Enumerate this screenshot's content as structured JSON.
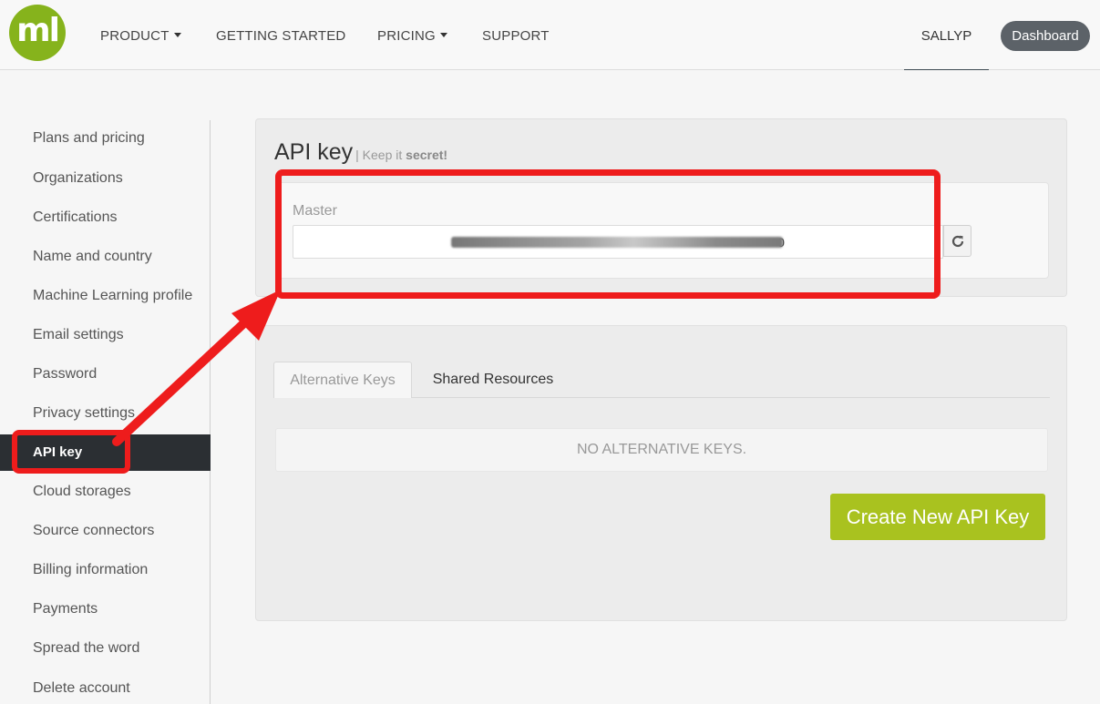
{
  "header": {
    "logo_text": "ml",
    "nav": [
      {
        "label": "PRODUCT",
        "has_caret": true
      },
      {
        "label": "GETTING STARTED",
        "has_caret": false
      },
      {
        "label": "PRICING",
        "has_caret": true
      },
      {
        "label": "SUPPORT",
        "has_caret": false
      }
    ],
    "username": "SALLYP",
    "dashboard_label": "Dashboard"
  },
  "sidebar": {
    "items": [
      {
        "label": "Plans and pricing"
      },
      {
        "label": "Organizations"
      },
      {
        "label": "Certifications"
      },
      {
        "label": "Name and country"
      },
      {
        "label": "Machine Learning profile"
      },
      {
        "label": "Email settings"
      },
      {
        "label": "Password"
      },
      {
        "label": "Privacy settings"
      },
      {
        "label": "API key",
        "active": true
      },
      {
        "label": "Cloud storages"
      },
      {
        "label": "Source connectors"
      },
      {
        "label": "Billing information"
      },
      {
        "label": "Payments"
      },
      {
        "label": "Spread the word"
      },
      {
        "label": "Delete account"
      }
    ]
  },
  "main": {
    "title": "API key",
    "subtitle_prefix": "| Keep it ",
    "subtitle_bold": "secret!",
    "master_label": "Master",
    "master_key_visible_tail": "0",
    "tabs": [
      {
        "label": "Alternative Keys",
        "active": true
      },
      {
        "label": "Shared Resources",
        "active": false
      }
    ],
    "empty_message": "NO ALTERNATIVE KEYS.",
    "create_button_label": "Create New API Key"
  },
  "colors": {
    "brand_green": "#86b31c",
    "create_button": "#a9c21f",
    "annotation_red": "#ee1c1c",
    "sidebar_active": "#2b2f33"
  },
  "icons": {
    "refresh": "refresh-icon",
    "caret": "caret-down-icon"
  }
}
